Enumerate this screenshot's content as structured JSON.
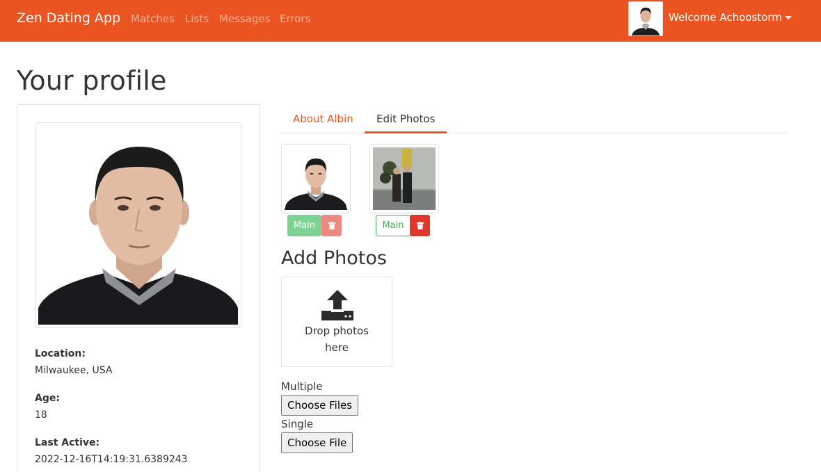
{
  "navbar": {
    "brand": "Zen Dating App",
    "links": [
      "Matches",
      "Lists",
      "Messages",
      "Errors"
    ],
    "welcome": "Welcome Achoostorm",
    "color": "#e95420"
  },
  "page": {
    "title": "Your profile"
  },
  "profile": {
    "location_label": "Location:",
    "location": "Milwaukee, USA",
    "age_label": "Age:",
    "age": "18",
    "last_active_label": "Last Active:",
    "last_active": "2022-12-16T14:19:31.6389243"
  },
  "tabs": [
    "About Albin",
    "Edit Photos"
  ],
  "photos": [
    {
      "main_label": "Main",
      "is_main": true
    },
    {
      "main_label": "Main",
      "is_main": false
    }
  ],
  "add_photos": {
    "title": "Add Photos",
    "drop_text_line1": "Drop photos",
    "drop_text_line2": "here",
    "multiple_label": "Multiple",
    "multiple_button": "Choose Files",
    "single_label": "Single",
    "single_button": "Choose File"
  },
  "icons": {
    "upload": "upload-icon",
    "trash": "trash-icon",
    "caret": "caret-down-icon"
  }
}
